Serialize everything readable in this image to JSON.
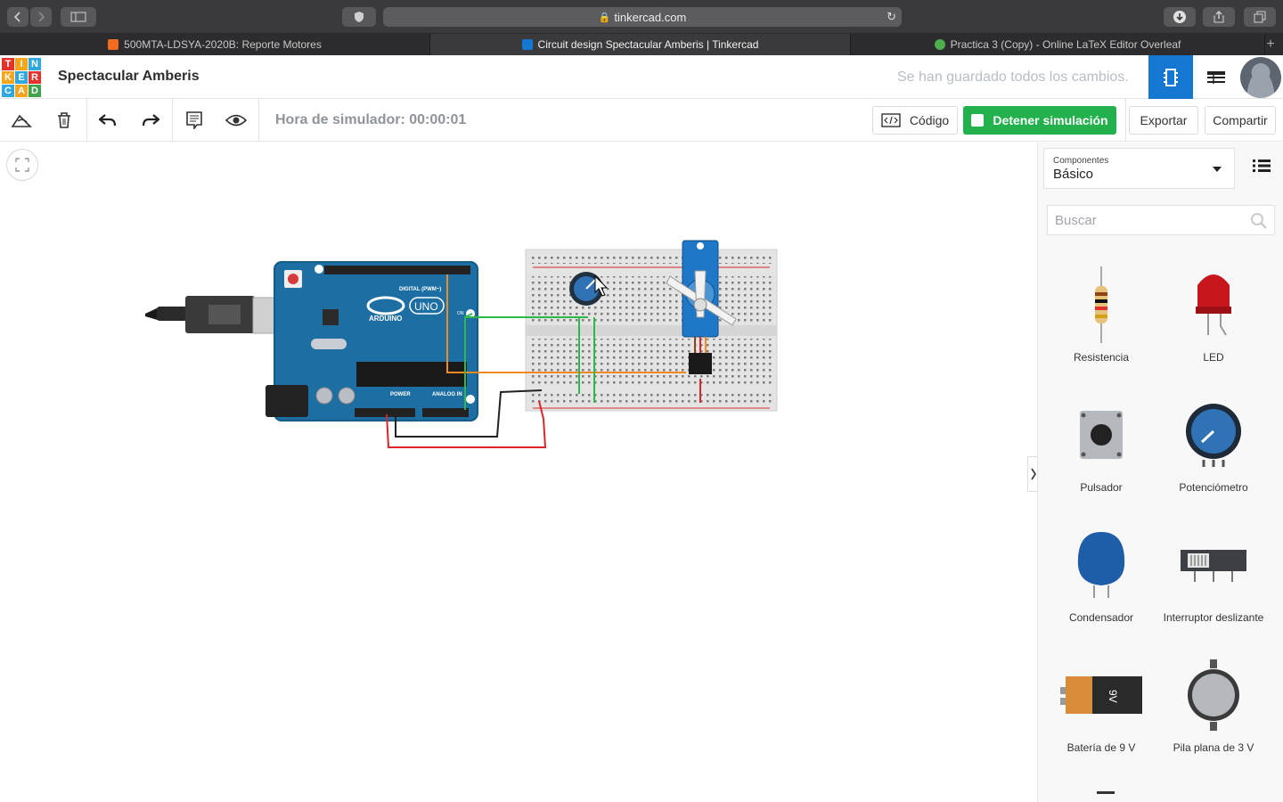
{
  "browser": {
    "url": "tinkercad.com",
    "tabs": [
      {
        "label": "500MTA-LDSYA-2020B: Reporte Motores",
        "active": false,
        "fav_color": "#f26b21"
      },
      {
        "label": "Circuit design Spectacular Amberis | Tinkercad",
        "active": true,
        "fav_color": "#1477d1"
      },
      {
        "label": "Practica 3 (Copy) - Online LaTeX Editor Overleaf",
        "active": false,
        "fav_color": "#4cae4f"
      }
    ],
    "new_tab": "+"
  },
  "header": {
    "logo_letters": [
      "T",
      "I",
      "N",
      "K",
      "E",
      "R",
      "C",
      "A",
      "D"
    ],
    "project_name": "Spectacular Amberis",
    "saved_status": "Se han guardado todos los cambios."
  },
  "toolbar": {
    "sim_time": "Hora de simulador: 00:00:01",
    "code_label": "Código",
    "stop_sim_label": "Detener simulación",
    "export_label": "Exportar",
    "share_label": "Compartir"
  },
  "panel": {
    "components_label": "Componentes",
    "components_value": "Básico",
    "search_placeholder": "Buscar",
    "items": [
      {
        "label": "Resistencia",
        "icon": "resistor-icon"
      },
      {
        "label": "LED",
        "icon": "led-icon"
      },
      {
        "label": "Pulsador",
        "icon": "pushbutton-icon"
      },
      {
        "label": "Potenciómetro",
        "icon": "potentiometer-icon"
      },
      {
        "label": "Condensador",
        "icon": "capacitor-icon"
      },
      {
        "label": "Interruptor deslizante",
        "icon": "slide-switch-icon"
      },
      {
        "label": "Batería de 9 V",
        "icon": "battery-9v-icon"
      },
      {
        "label": "Pila plana de 3 V",
        "icon": "coin-cell-icon"
      }
    ]
  },
  "board": {
    "brand": "ARDUINO",
    "model": "UNO",
    "digital_label": "DIGITAL (PWM~)",
    "power_label": "POWER",
    "analog_label": "ANALOG IN",
    "on_label": "ON",
    "battery_mark": "9V"
  },
  "colors": {
    "accent_blue": "#1477d1",
    "sim_green": "#22b14c",
    "arduino_blue": "#1d6fa3",
    "wire_green": "#2fb84a",
    "wire_orange": "#f08a24",
    "wire_red": "#d9262b",
    "wire_black": "#222222"
  }
}
